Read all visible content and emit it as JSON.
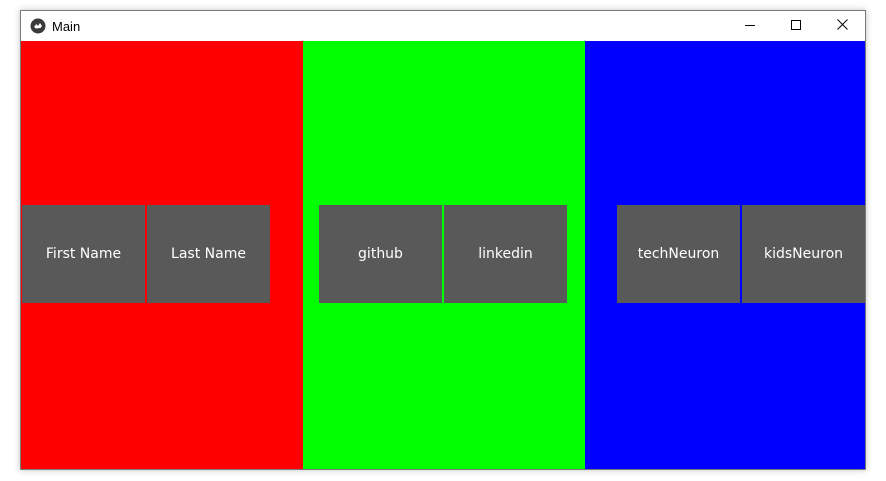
{
  "window": {
    "title": "Main",
    "app_icon": "kivy-logo-icon",
    "controls": {
      "minimize_icon": "minimize-icon",
      "maximize_icon": "maximize-icon",
      "close_icon": "close-icon"
    }
  },
  "panels": [
    {
      "color": "#ff0000",
      "buttons": [
        {
          "label": "First Name"
        },
        {
          "label": "Last Name"
        }
      ]
    },
    {
      "color": "#00ff00",
      "buttons": [
        {
          "label": "github"
        },
        {
          "label": "linkedin"
        }
      ]
    },
    {
      "color": "#0000ff",
      "buttons": [
        {
          "label": "techNeuron"
        },
        {
          "label": "kidsNeuron"
        }
      ]
    }
  ],
  "button_color": "#595959"
}
